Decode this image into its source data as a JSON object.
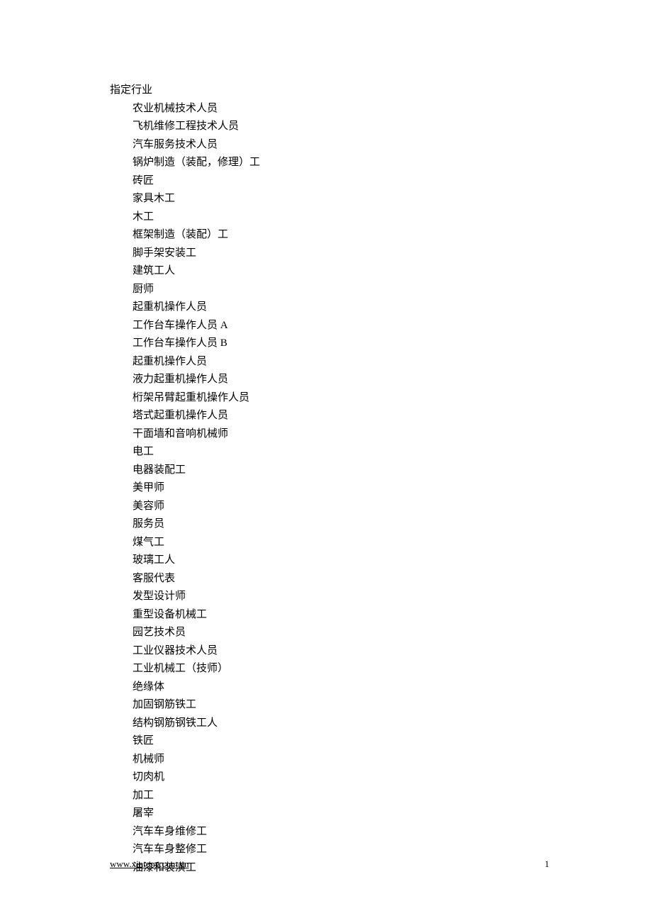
{
  "heading": "指定行业",
  "items": [
    "农业机械技术人员",
    "飞机维修工程技术人员",
    "汽车服务技术人员",
    "锅炉制造（装配，修理）工",
    "砖匠",
    "家具木工",
    "木工",
    "框架制造（装配）工",
    "脚手架安装工",
    "建筑工人",
    "厨师",
    "起重机操作人员",
    "工作台车操作人员 A",
    "工作台车操作人员 B",
    "起重机操作人员",
    "液力起重机操作人员",
    "桁架吊臂起重机操作人员",
    "塔式起重机操作人员",
    "干面墙和音响机械师",
    "电工",
    "电器装配工",
    "美甲师",
    "美容师",
    "服务员",
    "煤气工",
    "玻璃工人",
    "客服代表",
    "发型设计师",
    "重型设备机械工",
    "园艺技术员",
    "工业仪器技术人员",
    "工业机械工（技师）",
    "绝缘体",
    "加固钢筋铁工",
    "结构钢筋钢铁工人",
    "铁匠",
    "机械师",
    "切肉机",
    "加工",
    "屠宰",
    "汽车车身维修工",
    "汽车车身整修工",
    "油漆和装潢工"
  ],
  "footer": {
    "link": "www.xintong.com.cn",
    "page": "1"
  }
}
